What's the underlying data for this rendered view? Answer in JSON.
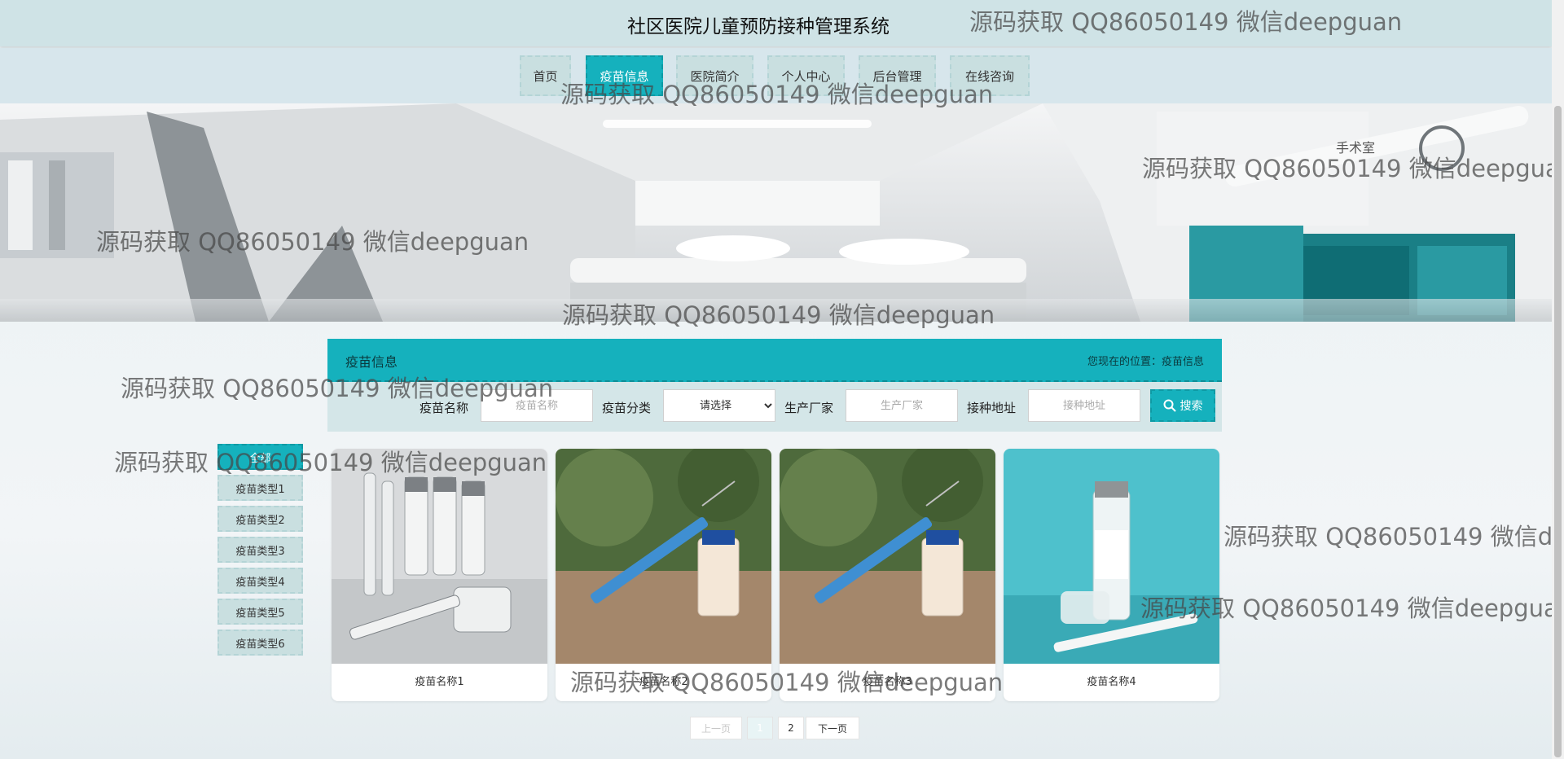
{
  "header": {
    "title": "社区医院儿童预防接种管理系统"
  },
  "nav": {
    "items": [
      {
        "label": "首页"
      },
      {
        "label": "疫苗信息"
      },
      {
        "label": "医院简介"
      },
      {
        "label": "个人中心"
      },
      {
        "label": "后台管理"
      },
      {
        "label": "在线咨询"
      }
    ]
  },
  "section": {
    "title": "疫苗信息",
    "breadcrumb": "您现在的位置：疫苗信息"
  },
  "search": {
    "name_label": "疫苗名称",
    "name_placeholder": "疫苗名称",
    "category_label": "疫苗分类",
    "category_selected": "请选择",
    "maker_label": "生产厂家",
    "maker_placeholder": "生产厂家",
    "address_label": "接种地址",
    "address_placeholder": "接种地址",
    "button_label": "搜索"
  },
  "categories": [
    {
      "label": "全部"
    },
    {
      "label": "疫苗类型1"
    },
    {
      "label": "疫苗类型2"
    },
    {
      "label": "疫苗类型3"
    },
    {
      "label": "疫苗类型4"
    },
    {
      "label": "疫苗类型5"
    },
    {
      "label": "疫苗类型6"
    }
  ],
  "cards": [
    {
      "title": "疫苗名称1"
    },
    {
      "title": "疫苗名称2"
    },
    {
      "title": "疫苗名称3"
    },
    {
      "title": "疫苗名称4"
    }
  ],
  "pagination": {
    "prev": "上一页",
    "pages": [
      "1",
      "2"
    ],
    "current": "1",
    "next": "下一页"
  },
  "banner": {
    "sign_text": "手术室"
  },
  "watermark": "源码获取 QQ86050149 微信deepguan",
  "colors": {
    "accent": "#15b1bd",
    "header_bg": "#cfe3e6",
    "nav_bg": "#d7e6ec"
  }
}
